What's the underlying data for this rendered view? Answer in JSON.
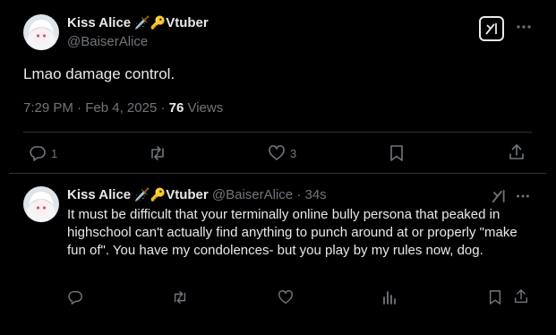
{
  "main_post": {
    "display_name": "Kiss Alice",
    "name_emojis": "🗡️🔑",
    "name_suffix": "Vtuber",
    "handle": "@BaiserAlice",
    "text": "Lmao damage control.",
    "time": "7:29 PM",
    "date": "Feb 4, 2025",
    "views_count": "76",
    "views_label": "Views",
    "actions": {
      "reply_count": "1",
      "repost_count": "",
      "like_count": "3"
    },
    "icons": [
      "avatar",
      "grok-icon",
      "more-icon",
      "reply-icon",
      "repost-icon",
      "like-icon",
      "bookmark-icon",
      "share-icon"
    ]
  },
  "reply_post": {
    "display_name": "Kiss Alice",
    "name_emojis": "🗡️🔑",
    "name_suffix": "Vtuber",
    "handle": "@BaiserAlice",
    "time": "34s",
    "text": "It must be difficult that your terminally online bully persona that peaked in highschool can't actually find anything to punch around at or properly \"make fun of\". You have my condolences- but you play by my rules now, dog.",
    "icons": [
      "avatar",
      "grok-icon",
      "more-icon",
      "reply-icon",
      "repost-icon",
      "like-icon",
      "views-icon",
      "bookmark-icon",
      "share-icon"
    ]
  },
  "colors": {
    "background": "#000000",
    "text": "#e7e9ea",
    "muted": "#71767b",
    "divider": "#2f3336"
  }
}
